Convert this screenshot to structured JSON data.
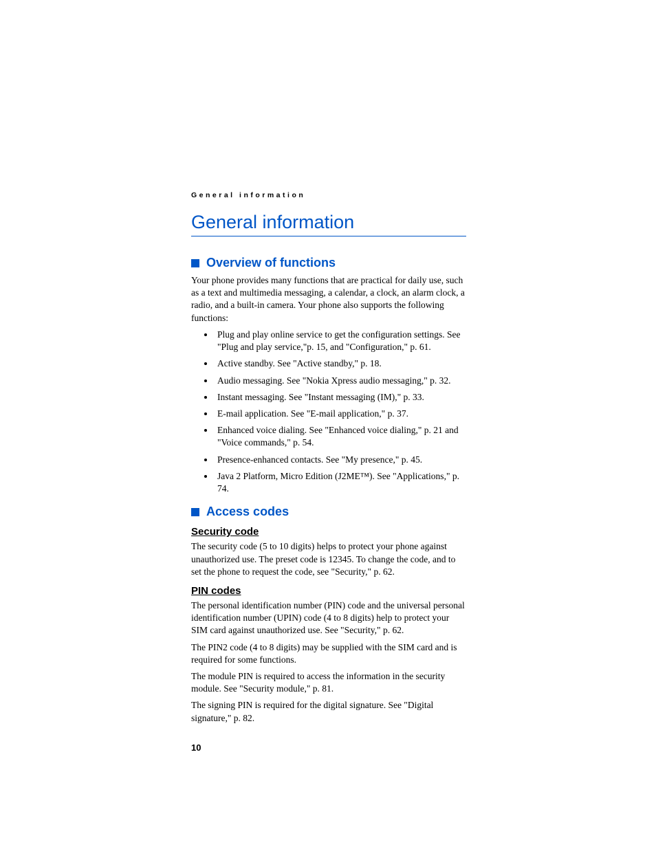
{
  "runningHeader": "General information",
  "chapterTitle": "General information",
  "section1": {
    "title": "Overview of functions",
    "intro": "Your phone provides many functions that are practical for daily use, such as a text and multimedia messaging, a calendar, a clock, an alarm clock, a radio, and a built-in camera. Your phone also supports the following functions:",
    "bullets": [
      "Plug and play online service to get the configuration settings. See \"Plug and play service,\"p. 15, and \"Configuration,\" p. 61.",
      "Active standby. See \"Active standby,\" p. 18.",
      "Audio messaging. See \"Nokia Xpress audio messaging,\" p. 32.",
      "Instant messaging. See \"Instant messaging (IM),\" p. 33.",
      "E-mail application. See \"E-mail application,\" p. 37.",
      "Enhanced voice dialing. See \"Enhanced voice dialing,\" p. 21 and \"Voice commands,\" p. 54.",
      "Presence-enhanced contacts. See \"My presence,\" p. 45.",
      "Java 2 Platform, Micro Edition (J2ME™). See \"Applications,\" p. 74."
    ]
  },
  "section2": {
    "title": "Access codes",
    "sub1": {
      "title": "Security code",
      "para1": "The security code (5 to 10 digits) helps to protect your phone against unauthorized use. The preset code is 12345. To change the code, and to set the phone to request the code, see \"Security,\" p. 62."
    },
    "sub2": {
      "title": "PIN codes",
      "para1": "The personal identification number (PIN) code and the universal personal identification number (UPIN) code (4 to 8 digits) help to protect your SIM card against unauthorized use. See \"Security,\" p. 62.",
      "para2": "The PIN2 code (4 to 8 digits) may be supplied with the SIM card and is required for some functions.",
      "para3": "The module PIN is required to access the information in the security module. See \"Security module,\" p. 81.",
      "para4": "The signing PIN is required for the digital signature. See \"Digital signature,\" p. 82."
    }
  },
  "pageNumber": "10"
}
